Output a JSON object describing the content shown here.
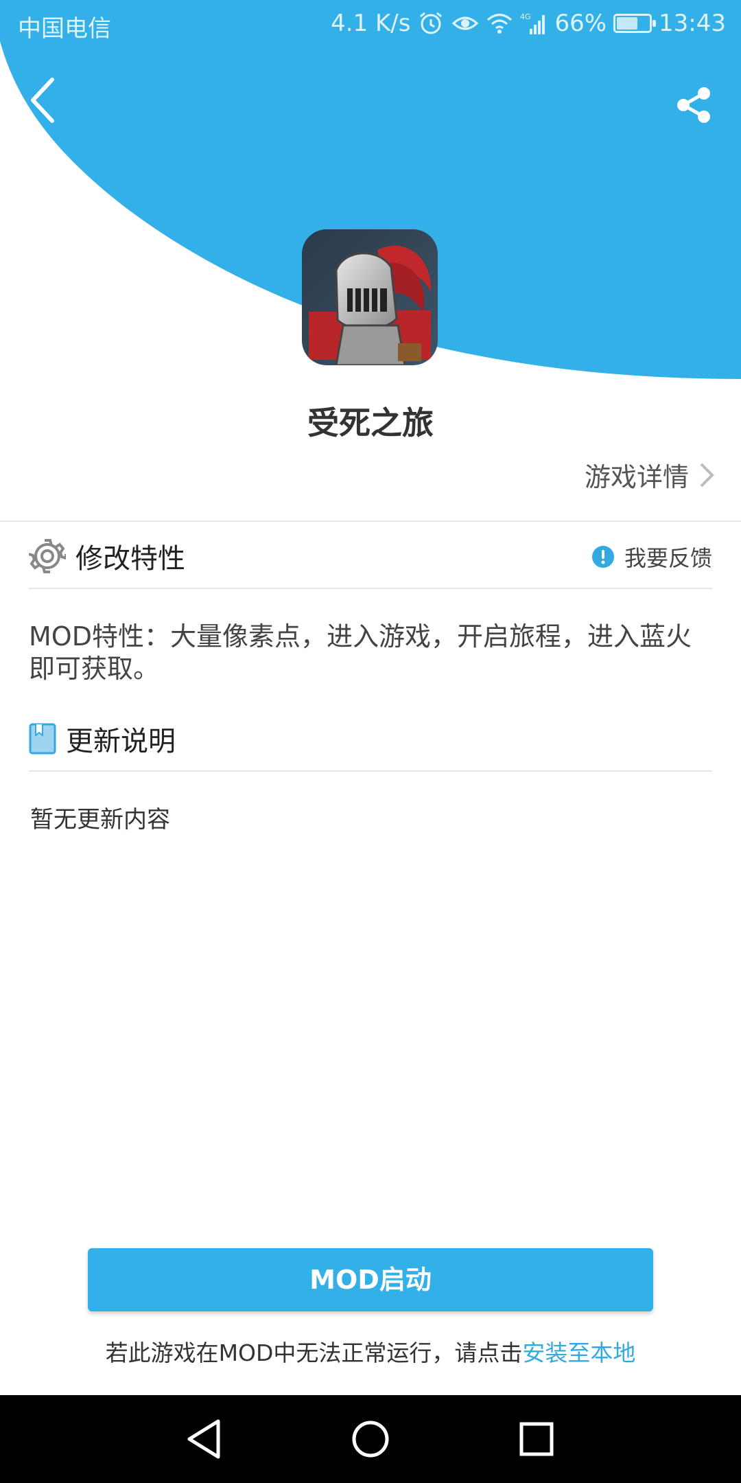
{
  "colors": {
    "accent": "#33b0e8",
    "link": "#33a9e2",
    "text": "#333333",
    "divider": "#e6e6e6",
    "nav_bar": "#000000"
  },
  "status_bar": {
    "carrier": "中国电信",
    "speed": "4.1 K/s",
    "network": "4G",
    "battery": "66%",
    "battery_level": 0.66,
    "time": "13:43",
    "icons": [
      "alarm-icon",
      "eye-comfort-icon",
      "wifi-icon",
      "signal-icon",
      "battery-icon"
    ]
  },
  "header": {
    "back_icon": "back-chevron-icon",
    "share_icon": "share-icon"
  },
  "game": {
    "title": "受死之旅",
    "details_link": "游戏详情"
  },
  "mod_section": {
    "title": "修改特性",
    "icon": "gear-icon",
    "feedback_label": "我要反馈",
    "feedback_icon": "exclamation-circle-icon",
    "description": "MOD特性：大量像素点，进入游戏，开启旅程，进入蓝火即可获取。"
  },
  "update_section": {
    "title": "更新说明",
    "icon": "book-icon",
    "content": "暂无更新内容"
  },
  "actions": {
    "launch_button": "MOD启动",
    "install_note_prefix": "若此游戏在MOD中无法正常运行，请点击",
    "install_link": "安装至本地"
  },
  "system_nav": {
    "back": "triangle-back-icon",
    "home": "circle-home-icon",
    "recents": "square-recents-icon"
  }
}
